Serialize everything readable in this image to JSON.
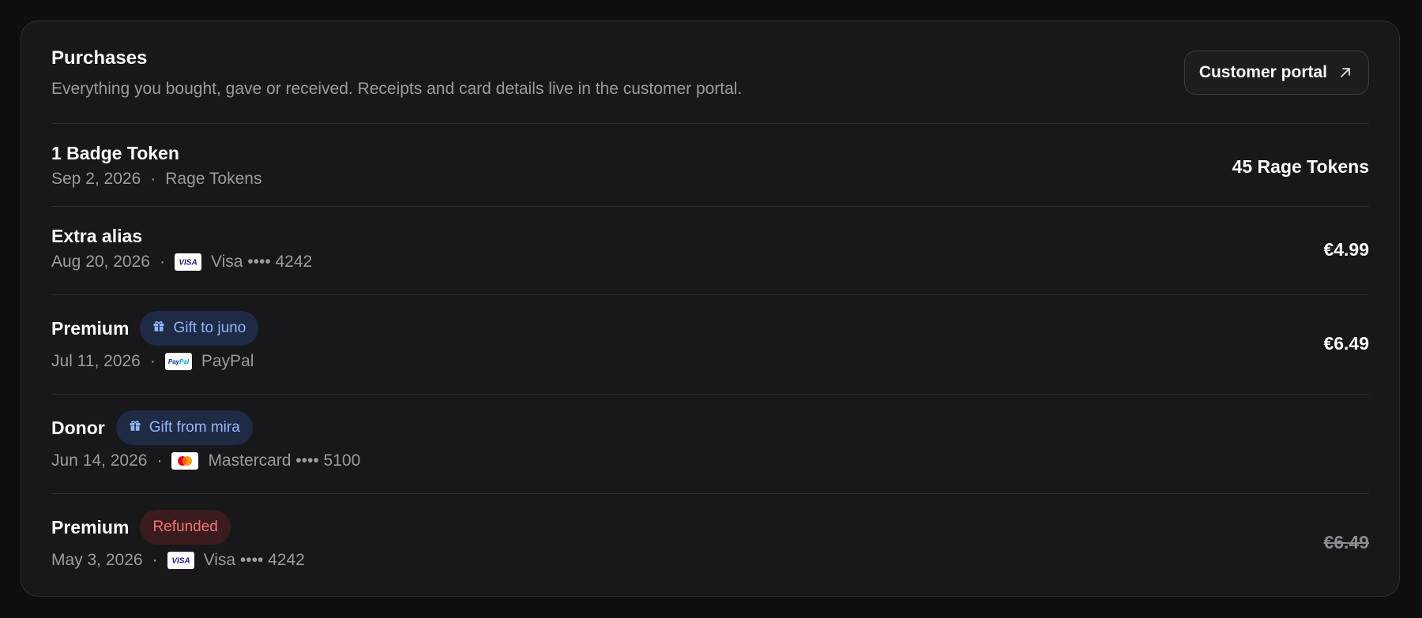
{
  "header": {
    "title": "Purchases",
    "subtitle": "Everything you bought, gave or received. Receipts and card details live in the customer portal.",
    "portal_button": "Customer portal"
  },
  "purchases": [
    {
      "name": "1 Badge Token",
      "date": "Sep 2, 2026",
      "method": "Rage Tokens",
      "amount": "45 Rage Tokens"
    },
    {
      "name": "Extra alias",
      "date": "Aug 20, 2026",
      "method_icon": "visa-icon",
      "method": "Visa •••• 4242",
      "amount": "€4.99"
    },
    {
      "name": "Premium",
      "badge": "Gift to juno",
      "badge_icon": "gift-icon",
      "date": "Jul 11, 2026",
      "method_icon": "paypal-icon",
      "method": "PayPal",
      "amount": "€6.49"
    },
    {
      "name": "Donor",
      "badge": "Gift from mira",
      "badge_icon": "gift-icon",
      "date": "Jun 14, 2026",
      "method_icon": "mastercard-icon",
      "method": "Mastercard •••• 5100",
      "amount": ""
    },
    {
      "name": "Premium",
      "badge": "Refunded",
      "date": "May 3, 2026",
      "method_icon": "visa-icon",
      "method": "Visa •••• 4242",
      "amount": "€6.49",
      "status": "refunded"
    }
  ],
  "colors": {
    "background": "#0e0e10",
    "card": "#18181b",
    "gift_badge_bg": "#1f2a45",
    "gift_badge_text": "#93b4f5",
    "refund_badge_bg": "#3a1c1e",
    "refund_badge_text": "#f07474",
    "muted_text": "#9a9aa2"
  }
}
